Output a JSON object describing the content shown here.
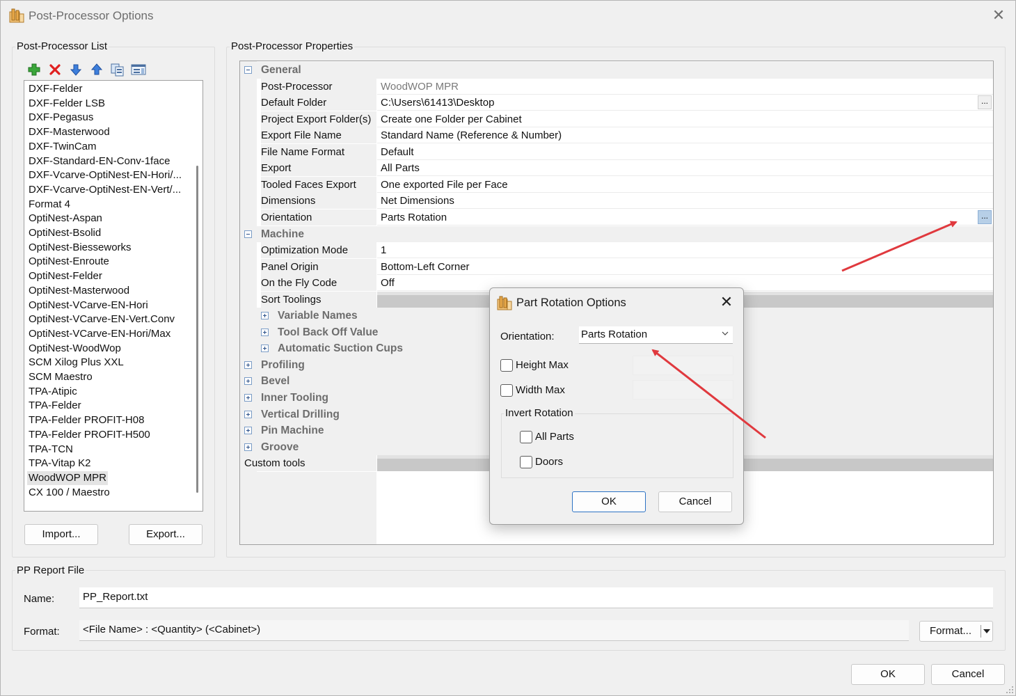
{
  "window": {
    "title": "Post-Processor Options",
    "close_glyph": "✕"
  },
  "left_panel": {
    "group_label": "Post-Processor List",
    "toolbar": [
      "add-icon",
      "delete-icon",
      "move-down-icon",
      "move-up-icon",
      "copy-icon",
      "properties-icon"
    ],
    "items": [
      "DXF-Felder",
      "DXF-Felder LSB",
      "DXF-Pegasus",
      "DXF-Masterwood",
      "DXF-TwinCam",
      "DXF-Standard-EN-Conv-1face",
      "DXF-Vcarve-OptiNest-EN-Hori/...",
      "DXF-Vcarve-OptiNest-EN-Vert/...",
      "Format 4",
      "OptiNest-Aspan",
      "OptiNest-Bsolid",
      "OptiNest-Biesseworks",
      "OptiNest-Enroute",
      "OptiNest-Felder",
      "OptiNest-Masterwood",
      "OptiNest-VCarve-EN-Hori",
      "OptiNest-VCarve-EN-Vert.Conv",
      "OptiNest-VCarve-EN-Hori/Max",
      "OptiNest-WoodWop",
      "SCM Xilog Plus XXL",
      "SCM Maestro",
      "TPA-Atipic",
      "TPA-Felder",
      "TPA-Felder PROFIT-H08",
      "TPA-Felder PROFIT-H500",
      "TPA-TCN",
      "TPA-Vitap K2",
      "WoodWOP MPR",
      "CX 100 / Maestro"
    ],
    "selected": "WoodWOP MPR",
    "import_label": "Import...",
    "export_label": "Export..."
  },
  "properties": {
    "group_label": "Post-Processor Properties",
    "general": {
      "label": "General",
      "rows": [
        {
          "name": "Post-Processor",
          "value": "WoodWOP MPR"
        },
        {
          "name": "Default Folder",
          "value": "C:\\Users\\61413\\Desktop"
        },
        {
          "name": "Project Export Folder(s)",
          "value": "Create one Folder per Cabinet"
        },
        {
          "name": "Export File Name",
          "value": "Standard Name (Reference & Number)"
        },
        {
          "name": "File Name Format",
          "value": "Default"
        },
        {
          "name": "Export",
          "value": "All Parts"
        },
        {
          "name": "Tooled Faces Export",
          "value": "One exported File per Face"
        },
        {
          "name": "Dimensions",
          "value": "Net Dimensions"
        },
        {
          "name": "Orientation",
          "value": "Parts Rotation"
        }
      ]
    },
    "machine": {
      "label": "Machine",
      "rows": [
        {
          "name": "Optimization Mode",
          "value": "1"
        },
        {
          "name": "Panel Origin",
          "value": "Bottom-Left Corner"
        },
        {
          "name": "On the Fly Code",
          "value": "Off"
        },
        {
          "name": "Sort Toolings",
          "value": ""
        }
      ],
      "subcategories": [
        "Variable Names",
        "Tool Back Off Value",
        "Automatic Suction Cups"
      ]
    },
    "categories": [
      "Profiling",
      "Bevel",
      "Inner Tooling",
      "Vertical Drilling",
      "Pin Machine",
      "Groove"
    ],
    "custom_tools": "Custom tools",
    "ellipsis": "..."
  },
  "report": {
    "group_label": "PP Report File",
    "name_label": "Name:",
    "name_value": "PP_Report.txt",
    "format_label": "Format:",
    "format_value": "<File Name> : <Quantity> (<Cabinet>)",
    "format_button": "Format..."
  },
  "footer": {
    "ok": "OK",
    "cancel": "Cancel"
  },
  "dialog": {
    "title": "Part Rotation Options",
    "close_glyph": "✕",
    "orientation_label": "Orientation:",
    "orientation_value": "Parts Rotation",
    "height_max": {
      "label": "Height Max",
      "checked": false
    },
    "width_max": {
      "label": "Width Max",
      "checked": false
    },
    "invert_rotation_label": "Invert Rotation",
    "all_parts": {
      "label": "All Parts",
      "checked": false
    },
    "doors": {
      "label": "Doors",
      "checked": false
    },
    "ok": "OK",
    "cancel": "Cancel"
  },
  "colors": {
    "annotation_arrow": "#e0393e",
    "accent": "#2c72c4"
  }
}
